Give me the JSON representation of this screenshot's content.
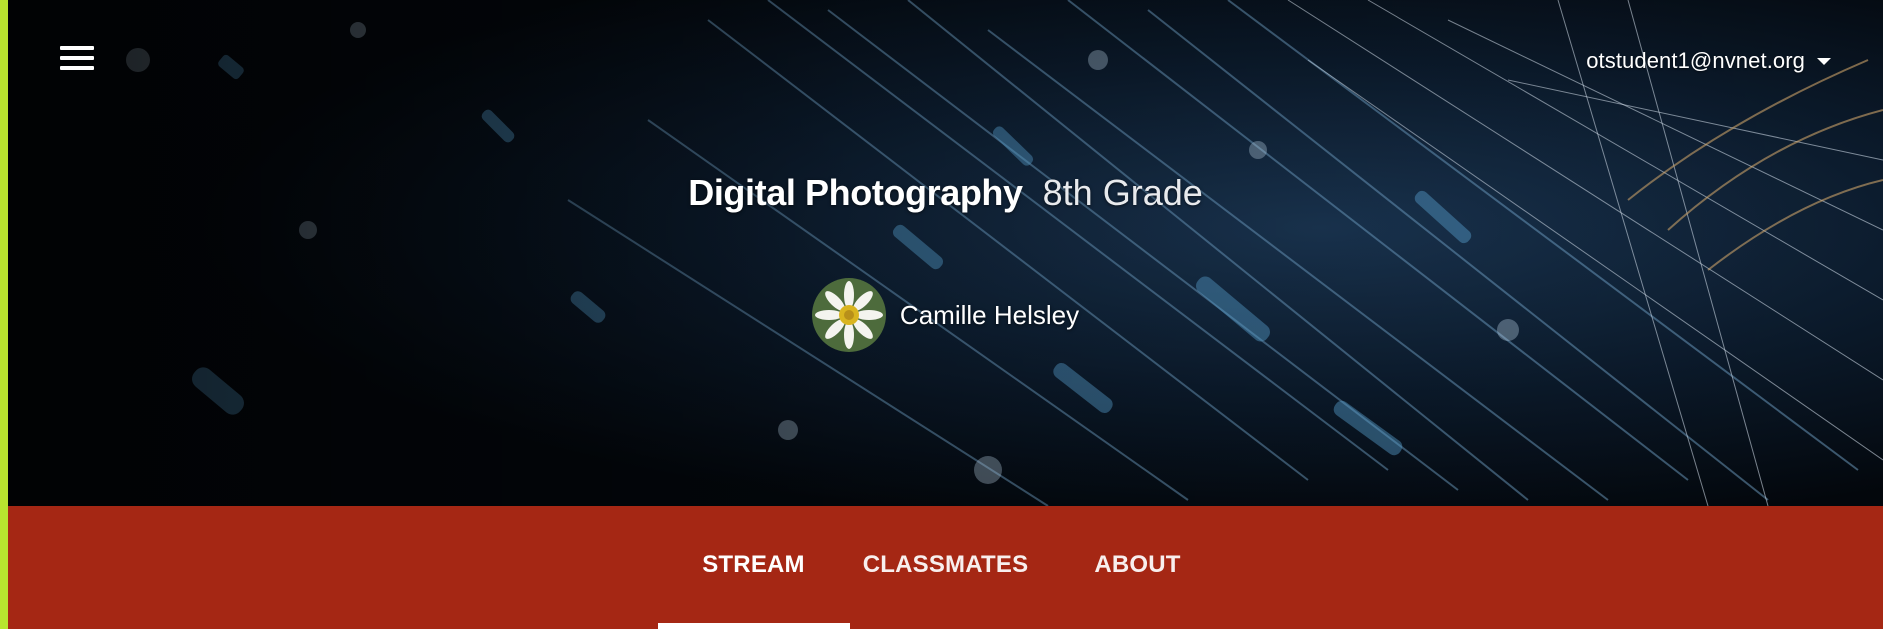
{
  "header": {
    "menu_icon": "hamburger-menu-icon",
    "account": {
      "email": "otstudent1@nvnet.org",
      "dropdown_icon": "caret-down-icon"
    }
  },
  "course": {
    "name": "Digital Photography",
    "section": "8th Grade",
    "teacher": {
      "name": "Camille Helsley",
      "avatar_icon": "daisy-avatar-icon"
    }
  },
  "tabs": [
    {
      "label": "STREAM",
      "active": true
    },
    {
      "label": "CLASSMATES",
      "active": false
    },
    {
      "label": "ABOUT",
      "active": false
    }
  ],
  "colors": {
    "tab_bar": "#a52714",
    "left_edge": "#b8e42f",
    "banner_base": "#04090f"
  }
}
